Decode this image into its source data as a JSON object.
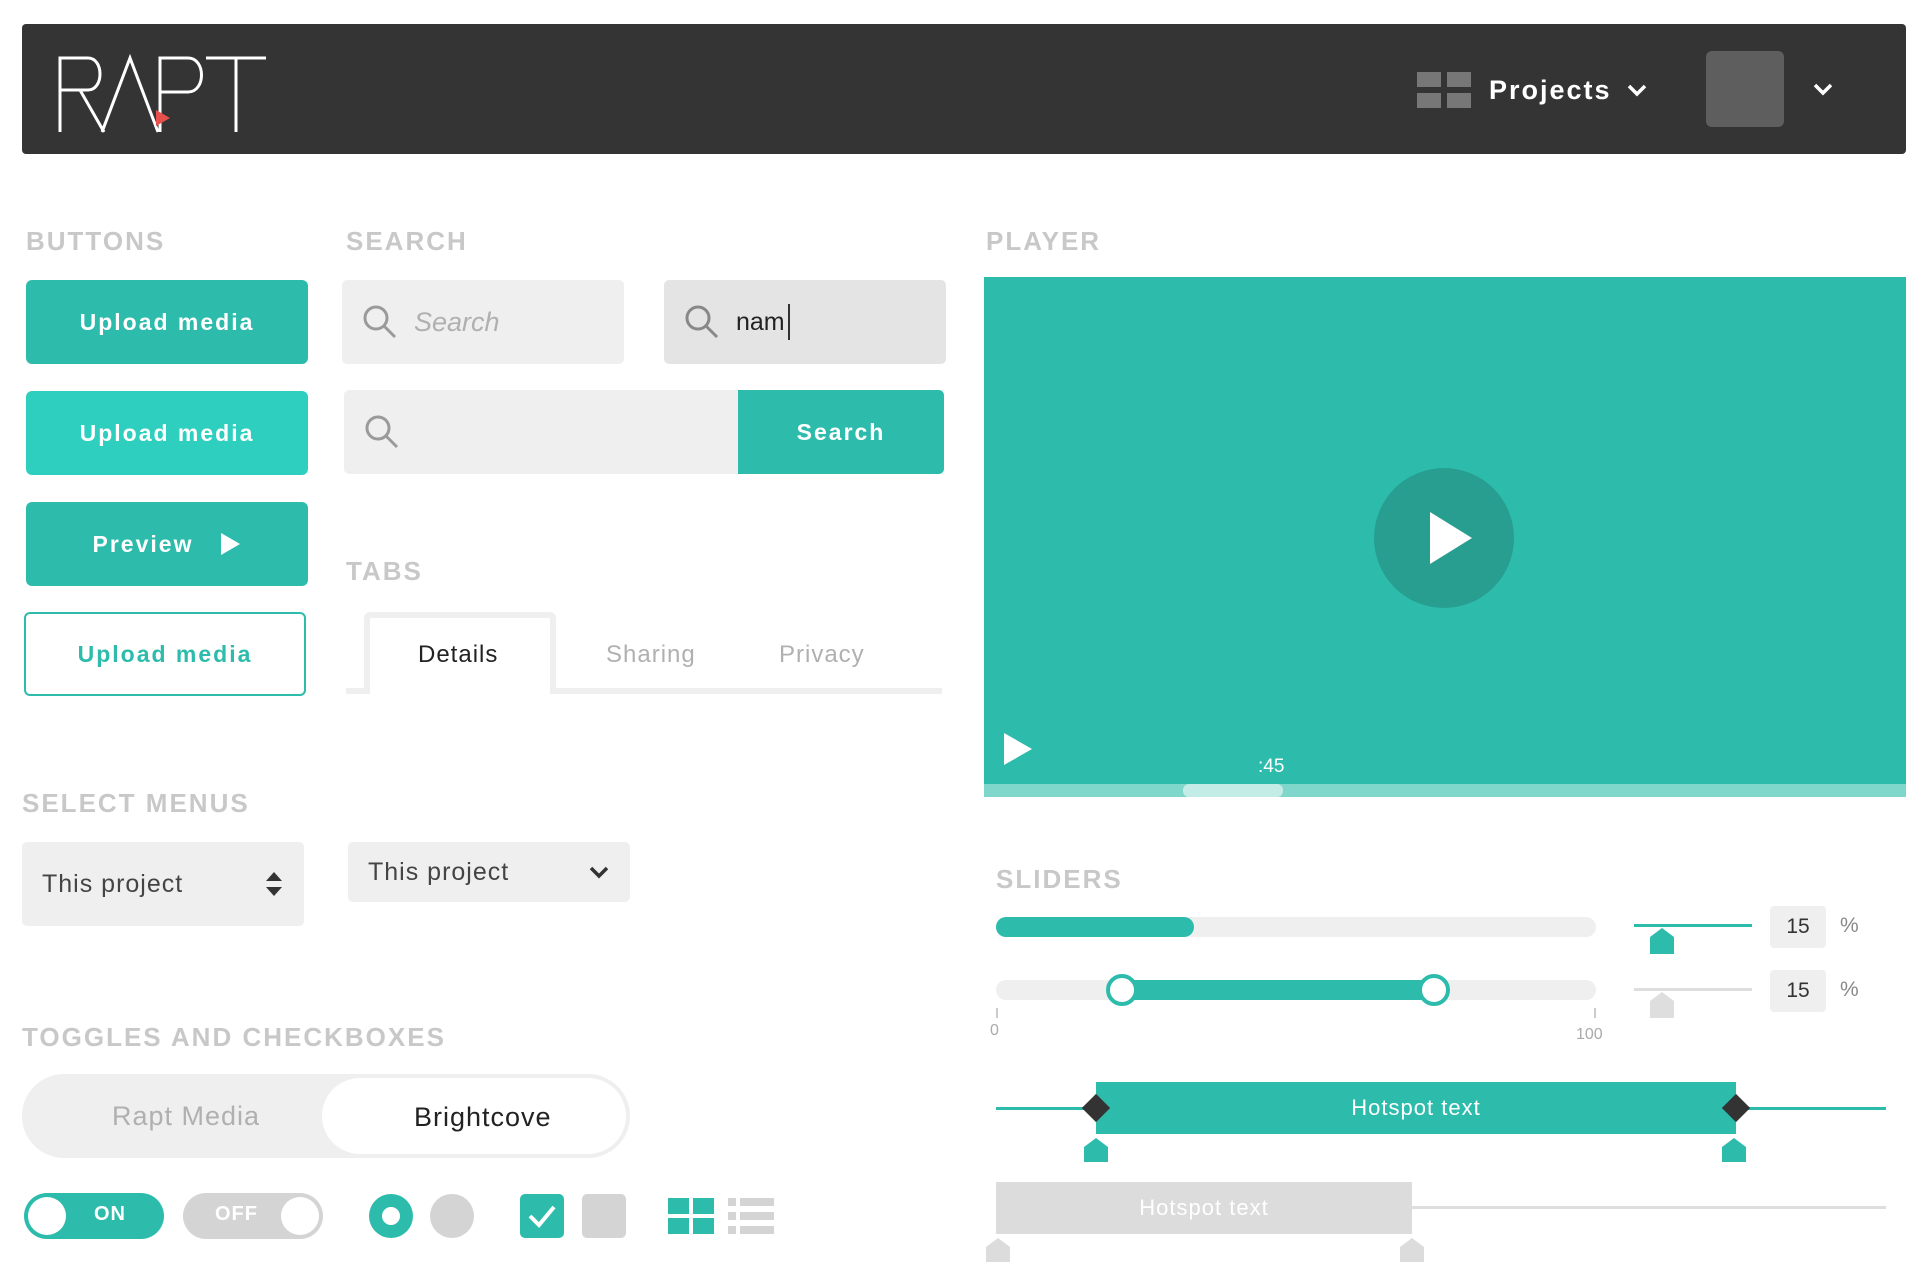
{
  "header": {
    "logo_text": "RAPT",
    "projects_label": "Projects"
  },
  "sections": {
    "buttons": "BUTTONS",
    "search": "SEARCH",
    "player": "PLAYER",
    "tabs": "TABS",
    "select_menus": "SELECT MENUS",
    "sliders": "SLIDERS",
    "toggles": "TOGGLES AND CHECKBOXES"
  },
  "buttons": {
    "upload_primary": "Upload media",
    "upload_light": "Upload media",
    "preview": "Preview",
    "upload_outline": "Upload media"
  },
  "search": {
    "placeholder": "Search",
    "typed_value": "nam",
    "submit_label": "Search"
  },
  "tabs": [
    {
      "label": "Details",
      "active": true
    },
    {
      "label": "Sharing",
      "active": false
    },
    {
      "label": "Privacy",
      "active": false
    }
  ],
  "selects": {
    "stepper_value": "This project",
    "dropdown_value": "This project"
  },
  "toggles": {
    "segment_left": "Rapt Media",
    "segment_right": "Brightcove",
    "on_label": "ON",
    "off_label": "OFF"
  },
  "player": {
    "time_label": ":45",
    "progress": 0.27
  },
  "sliders": {
    "single_fill": 0.33,
    "range_low": 0.21,
    "range_high": 0.73,
    "min_label": "0",
    "max_label": "100",
    "value_1": "15",
    "value_2": "15",
    "unit": "%",
    "hotspot_active_text": "Hotspot text",
    "hotspot_inactive_text": "Hotspot text"
  },
  "colors": {
    "accent": "#2dbcab",
    "accent_light": "#2fcfc0",
    "header_bg": "#343434",
    "heading_gray": "#c8c8c8"
  }
}
